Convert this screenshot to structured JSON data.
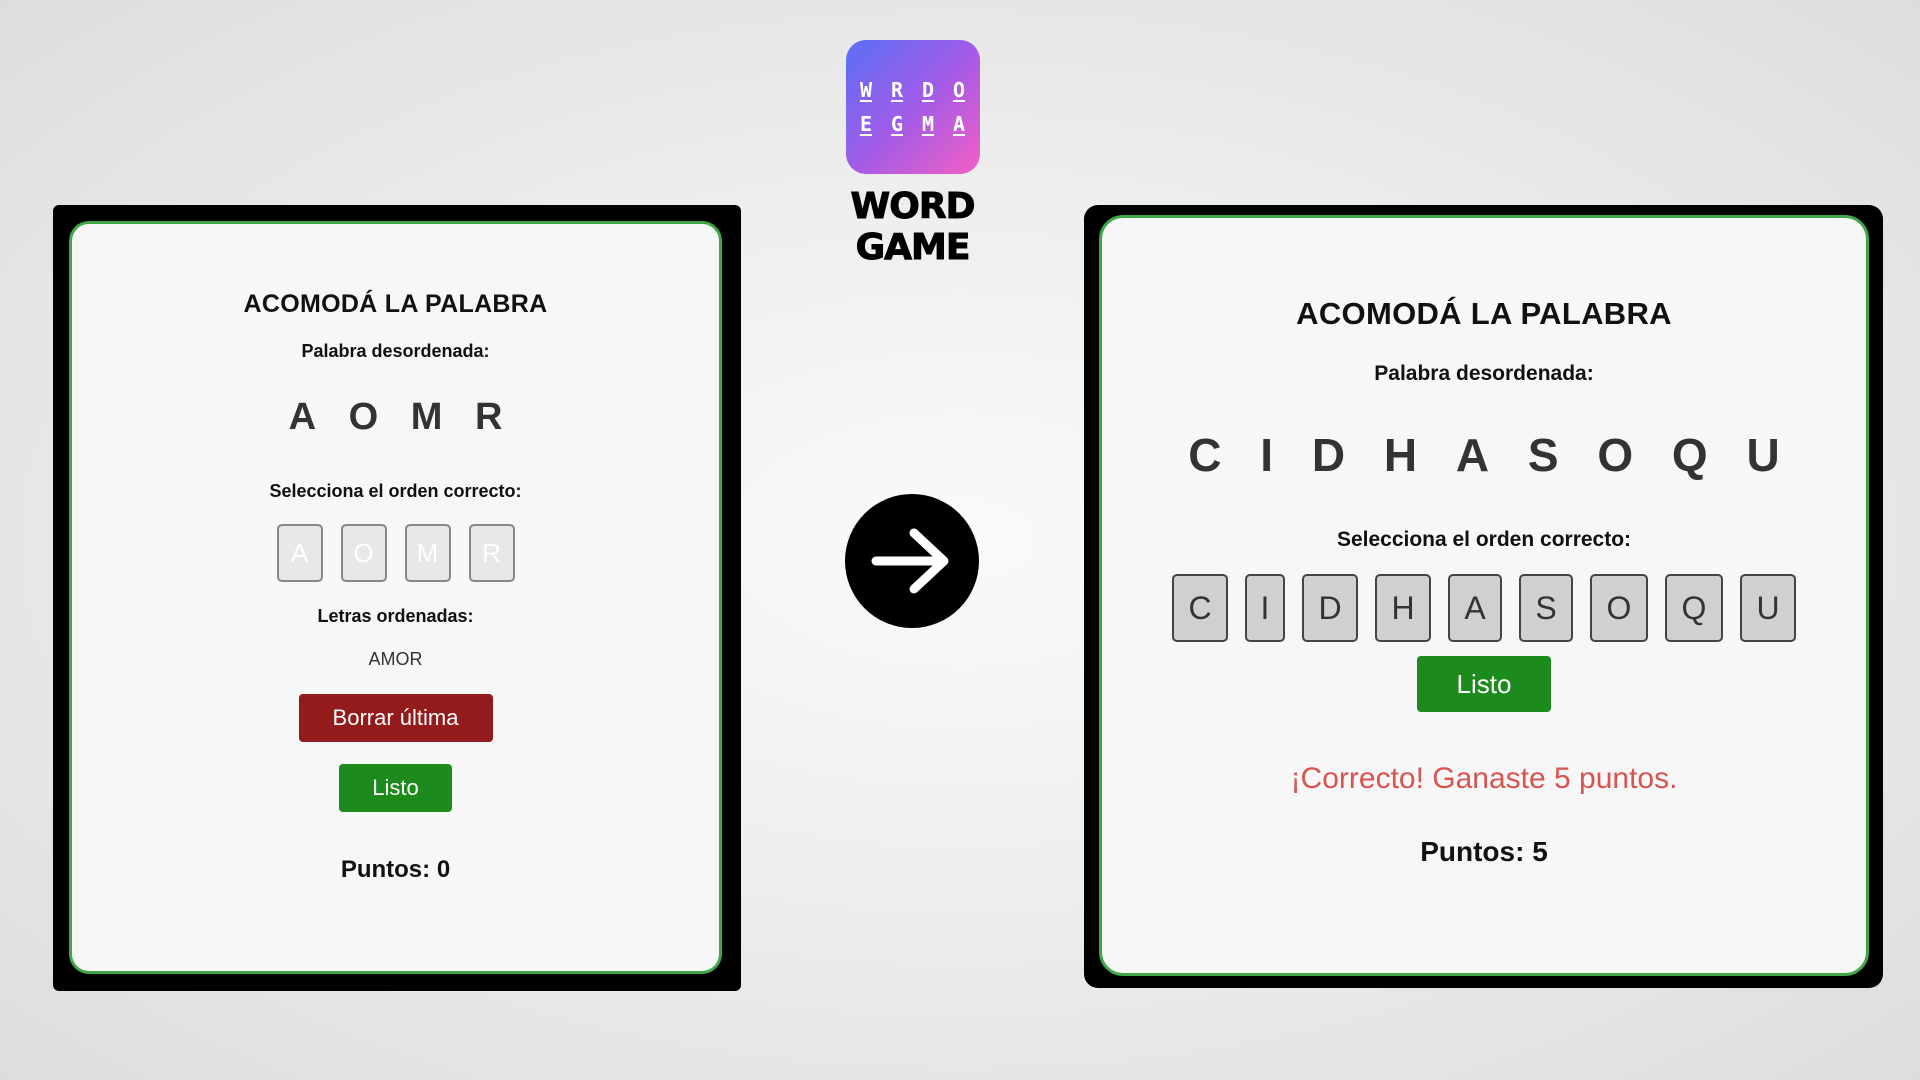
{
  "brand": {
    "icon_rows": [
      [
        "W",
        "R",
        "D",
        "O"
      ],
      [
        "E",
        "G",
        "M",
        "A"
      ]
    ],
    "name": "WORD GAME",
    "gradient": [
      "#5b6ff5",
      "#f35ec3"
    ]
  },
  "left_screen": {
    "title": "ACOMODÁ LA PALABRA",
    "scrambled_label": "Palabra desordenada:",
    "scrambled_letters": [
      "A",
      "O",
      "M",
      "R"
    ],
    "select_label": "Selecciona el orden correcto:",
    "tiles": [
      "A",
      "O",
      "M",
      "R"
    ],
    "ordered_label": "Letras ordenadas:",
    "ordered_value": "AMOR",
    "delete_button": "Borrar última",
    "done_button": "Listo",
    "score": "Puntos: 0"
  },
  "arrow": {
    "icon": "arrow-right-icon"
  },
  "right_screen": {
    "title": "ACOMODÁ LA PALABRA",
    "scrambled_label": "Palabra desordenada:",
    "scrambled_letters": [
      "C",
      "I",
      "D",
      "H",
      "A",
      "S",
      "O",
      "Q",
      "U"
    ],
    "select_label": "Selecciona el orden correcto:",
    "tiles": [
      "C",
      "I",
      "D",
      "H",
      "A",
      "S",
      "O",
      "Q",
      "U"
    ],
    "done_button": "Listo",
    "message": "¡Correcto! Ganaste 5 puntos.",
    "message_color": "#d9534f",
    "score": "Puntos: 5"
  },
  "colors": {
    "card_border": "#3fa64a",
    "delete": "#941b1b",
    "done": "#1c8a1c"
  }
}
